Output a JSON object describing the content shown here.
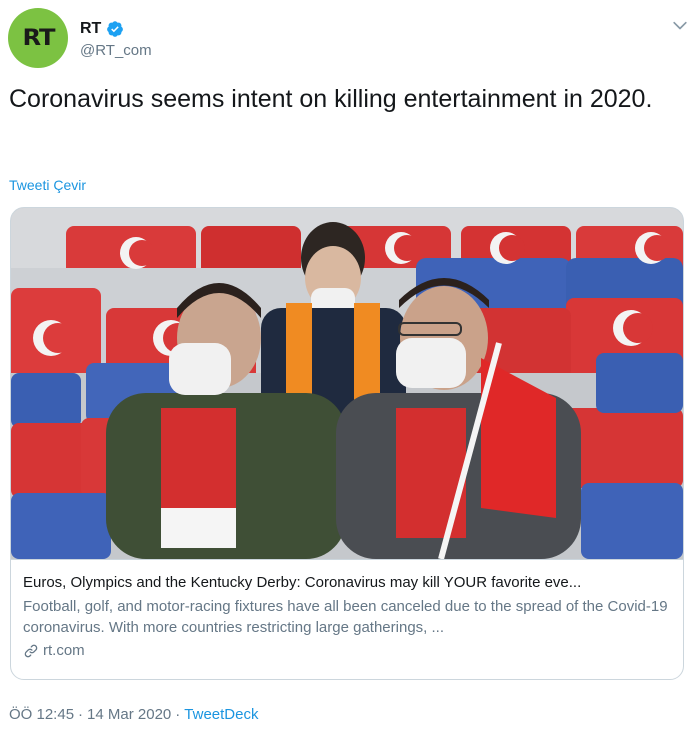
{
  "author": {
    "name": "RT",
    "handle": "@RT_com",
    "avatar_text": "RT",
    "avatar_color": "#7cc242"
  },
  "tweet": {
    "text": "Coronavirus seems intent on killing entertainment in 2020.",
    "translate_label": "Tweeti Çevir"
  },
  "card": {
    "title": "Euros, Olympics and the Kentucky Derby: Coronavirus may kill YOUR favorite eve...",
    "description": "Football, golf, and motor-racing fixtures have all been canceled due to the spread of the Covid-19 coronavirus. With more countries restricting large gatherings, ...",
    "domain": "rt.com",
    "image_icon": "photo-of-masked-football-fans"
  },
  "meta": {
    "time": "ÖÖ 12:45",
    "separator1": "·",
    "date": "14 Mar 2020",
    "separator2": "·",
    "source": "TweetDeck"
  },
  "colors": {
    "accent": "#1b95e0",
    "secondary_text": "#657786",
    "border": "#ccd6dd"
  }
}
